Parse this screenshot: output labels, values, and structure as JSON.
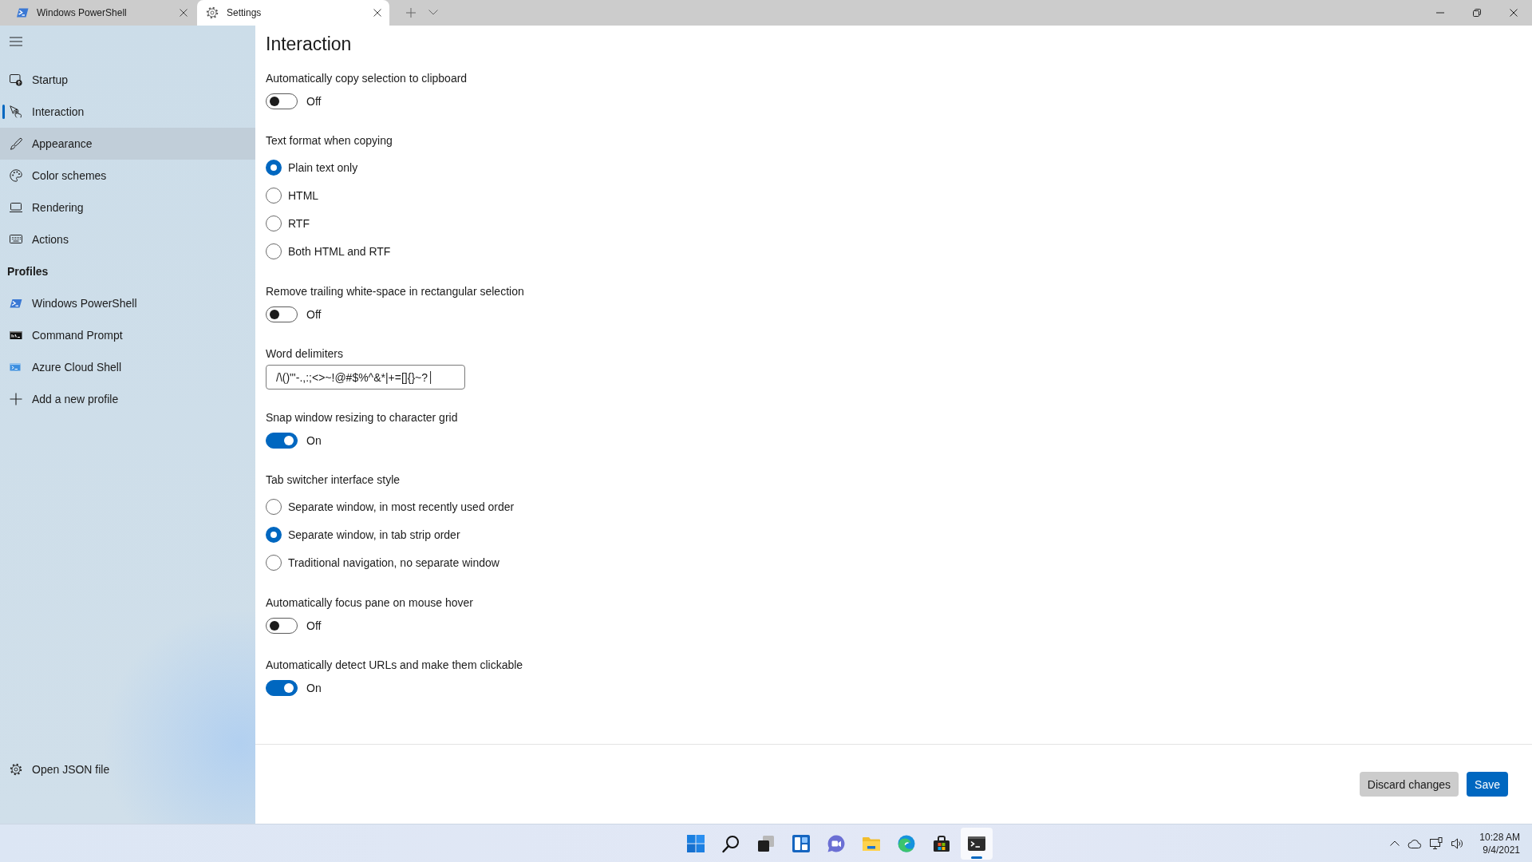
{
  "tabs": [
    {
      "label": "Windows PowerShell",
      "kind": "prompt",
      "selected": false
    },
    {
      "label": "Settings",
      "kind": "settings",
      "selected": true
    }
  ],
  "sidebar": {
    "items": [
      {
        "label": "Startup",
        "kind": "startup",
        "selected": false,
        "hovered": false
      },
      {
        "label": "Interaction",
        "kind": "interaction",
        "selected": true,
        "hovered": false
      },
      {
        "label": "Appearance",
        "kind": "appearance",
        "selected": false,
        "hovered": true
      },
      {
        "label": "Color schemes",
        "kind": "colors",
        "selected": false,
        "hovered": false
      },
      {
        "label": "Rendering",
        "kind": "rendering",
        "selected": false,
        "hovered": false
      },
      {
        "label": "Actions",
        "kind": "actions",
        "selected": false,
        "hovered": false
      }
    ],
    "profiles_heading": "Profiles",
    "profiles": [
      {
        "label": "Windows PowerShell",
        "kind": "powershell",
        "selected": false,
        "hovered": false
      },
      {
        "label": "Command Prompt",
        "kind": "cmd",
        "selected": false,
        "hovered": false
      },
      {
        "label": "Azure Cloud Shell",
        "kind": "cloud",
        "selected": false,
        "hovered": false
      },
      {
        "label": "Add a new profile",
        "kind": "add",
        "selected": false,
        "hovered": false
      }
    ],
    "footer_item": {
      "label": "Open JSON file"
    }
  },
  "page": {
    "title": "Interaction",
    "settings": [
      {
        "kind": "toggle",
        "label": "Automatically copy selection to clipboard",
        "on": false,
        "state_text": "Off"
      },
      {
        "kind": "radio",
        "label": "Text format when copying",
        "options": [
          {
            "label": "Plain text only",
            "selected": true
          },
          {
            "label": "HTML",
            "selected": false
          },
          {
            "label": "RTF",
            "selected": false
          },
          {
            "label": "Both HTML and RTF",
            "selected": false
          }
        ]
      },
      {
        "kind": "toggle",
        "label": "Remove trailing white-space in rectangular selection",
        "on": false,
        "state_text": "Off"
      },
      {
        "kind": "text",
        "label": "Word delimiters",
        "value": "/\\()\"'-.,:;<>~!@#$%^&*|+=[]{}~?│"
      },
      {
        "kind": "toggle",
        "label": "Snap window resizing to character grid",
        "on": true,
        "state_text": "On"
      },
      {
        "kind": "radio",
        "label": "Tab switcher interface style",
        "options": [
          {
            "label": "Separate window, in most recently used order",
            "selected": false
          },
          {
            "label": "Separate window, in tab strip order",
            "selected": true
          },
          {
            "label": "Traditional navigation, no separate window",
            "selected": false
          }
        ]
      },
      {
        "kind": "toggle",
        "label": "Automatically focus pane on mouse hover",
        "on": false,
        "state_text": "Off"
      },
      {
        "kind": "toggle",
        "label": "Automatically detect URLs and make them clickable",
        "on": true,
        "state_text": "On"
      }
    ]
  },
  "actions": [
    {
      "label": "Discard changes",
      "kind": "secondary"
    },
    {
      "label": "Save",
      "kind": "primary"
    }
  ],
  "taskbar": {
    "apps": [
      {
        "kind": "start",
        "active": false
      },
      {
        "kind": "search",
        "active": false
      },
      {
        "kind": "taskview",
        "active": false
      },
      {
        "kind": "widgets",
        "active": false
      },
      {
        "kind": "chat",
        "active": false
      },
      {
        "kind": "explorer",
        "active": false
      },
      {
        "kind": "browser",
        "active": false
      },
      {
        "kind": "store",
        "active": false
      },
      {
        "kind": "terminal",
        "active": true
      }
    ],
    "clock": {
      "time": "10:28 AM",
      "date": "9/4/2021"
    }
  }
}
